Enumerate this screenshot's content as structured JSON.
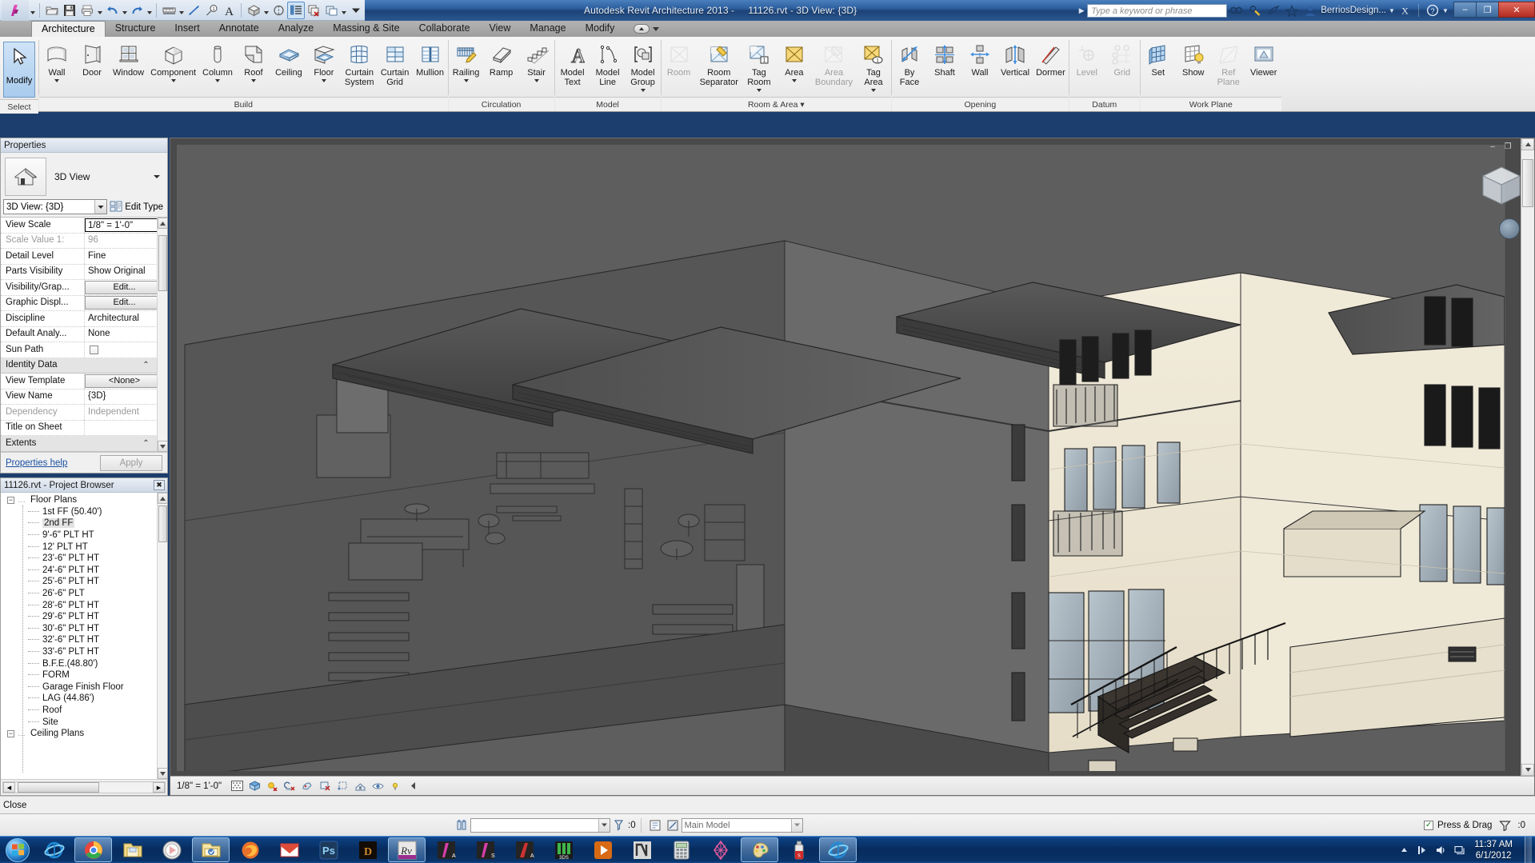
{
  "titlebar": {
    "app_title": "Autodesk Revit Architecture 2013 -",
    "document_title": "11126.rvt - 3D View: {3D}",
    "search_placeholder": "Type a keyword or phrase",
    "account": "BerriosDesign...",
    "quick_access": [
      {
        "name": "open-icon",
        "label": "Open"
      },
      {
        "name": "save-icon",
        "label": "Save"
      },
      {
        "name": "print-icon",
        "label": "Print"
      },
      {
        "name": "undo-icon",
        "label": "Undo"
      },
      {
        "name": "redo-icon",
        "label": "Redo"
      },
      {
        "name": "measure-icon",
        "label": "Measure"
      },
      {
        "name": "aligned-dimension-icon",
        "label": "Aligned Dimension"
      },
      {
        "name": "tag-icon",
        "label": "Tag by Category"
      },
      {
        "name": "text-icon",
        "label": "Text"
      },
      {
        "name": "default-3d-view-icon",
        "label": "Default 3D View"
      },
      {
        "name": "section-icon",
        "label": "Section"
      },
      {
        "name": "thin-lines-icon",
        "label": "Thin Lines"
      },
      {
        "name": "close-hidden-windows-icon",
        "label": "Close Hidden Windows"
      },
      {
        "name": "switch-windows-icon",
        "label": "Switch Windows"
      }
    ],
    "window_buttons": {
      "minimize": "–",
      "restore": "❐",
      "close": "✕"
    }
  },
  "tabs": [
    {
      "label": "Architecture",
      "active": true
    },
    {
      "label": "Structure",
      "active": false
    },
    {
      "label": "Insert",
      "active": false
    },
    {
      "label": "Annotate",
      "active": false
    },
    {
      "label": "Analyze",
      "active": false
    },
    {
      "label": "Massing & Site",
      "active": false
    },
    {
      "label": "Collaborate",
      "active": false
    },
    {
      "label": "View",
      "active": false
    },
    {
      "label": "Manage",
      "active": false
    },
    {
      "label": "Modify",
      "active": false
    }
  ],
  "ribbon": {
    "panels": [
      {
        "label": "Select",
        "buttons": [
          {
            "name": "modify-button",
            "label": "Modify",
            "icon": "cursor-arrow-icon",
            "selected": true,
            "disabled": false
          }
        ]
      },
      {
        "label": "Build",
        "buttons": [
          {
            "name": "wall-button",
            "label": "Wall",
            "icon": "wall-icon",
            "dropdown": true,
            "disabled": false
          },
          {
            "name": "door-button",
            "label": "Door",
            "icon": "door-icon",
            "dropdown": false,
            "disabled": false
          },
          {
            "name": "window-button",
            "label": "Window",
            "icon": "window-icon",
            "dropdown": false,
            "disabled": false
          },
          {
            "name": "component-button",
            "label": "Component",
            "icon": "component-icon",
            "dropdown": true,
            "disabled": false
          },
          {
            "name": "column-button",
            "label": "Column",
            "icon": "column-icon",
            "dropdown": true,
            "disabled": false
          },
          {
            "name": "roof-button",
            "label": "Roof",
            "icon": "roof-icon",
            "dropdown": true,
            "disabled": false
          },
          {
            "name": "ceiling-button",
            "label": "Ceiling",
            "icon": "ceiling-icon",
            "dropdown": false,
            "disabled": false
          },
          {
            "name": "floor-button",
            "label": "Floor",
            "icon": "floor-icon",
            "dropdown": true,
            "disabled": false
          },
          {
            "name": "curtain-system-button",
            "label": "Curtain",
            "label2": "System",
            "icon": "curtain-system-icon",
            "dropdown": false,
            "disabled": false
          },
          {
            "name": "curtain-grid-button",
            "label": "Curtain",
            "label2": "Grid",
            "icon": "curtain-grid-icon",
            "dropdown": false,
            "disabled": false
          },
          {
            "name": "mullion-button",
            "label": "Mullion",
            "icon": "mullion-icon",
            "dropdown": false,
            "disabled": false
          }
        ]
      },
      {
        "label": "Circulation",
        "buttons": [
          {
            "name": "railing-button",
            "label": "Railing",
            "icon": "railing-icon",
            "dropdown": true,
            "disabled": false
          },
          {
            "name": "ramp-button",
            "label": "Ramp",
            "icon": "ramp-icon",
            "dropdown": false,
            "disabled": false
          },
          {
            "name": "stair-button",
            "label": "Stair",
            "icon": "stair-icon",
            "dropdown": true,
            "disabled": false
          }
        ]
      },
      {
        "label": "Model",
        "buttons": [
          {
            "name": "model-text-button",
            "label": "Model",
            "label2": "Text",
            "icon": "model-text-icon",
            "dropdown": false,
            "disabled": false
          },
          {
            "name": "model-line-button",
            "label": "Model",
            "label2": "Line",
            "icon": "model-line-icon",
            "dropdown": false,
            "disabled": false
          },
          {
            "name": "model-group-button",
            "label": "Model",
            "label2": "Group",
            "icon": "model-group-icon",
            "dropdown": true,
            "disabled": false
          }
        ]
      },
      {
        "label": "Room & Area",
        "dropdown": true,
        "buttons": [
          {
            "name": "room-button",
            "label": "Room",
            "icon": "room-icon",
            "dropdown": false,
            "disabled": true
          },
          {
            "name": "room-separator-button",
            "label": "Room",
            "label2": "Separator",
            "icon": "room-separator-icon",
            "dropdown": false,
            "disabled": false
          },
          {
            "name": "tag-room-button",
            "label": "Tag",
            "label2": "Room",
            "icon": "tag-room-icon",
            "dropdown": true,
            "disabled": false
          },
          {
            "name": "area-button",
            "label": "Area",
            "icon": "area-icon",
            "dropdown": true,
            "disabled": false
          },
          {
            "name": "area-boundary-button",
            "label": "Area",
            "label2": "Boundary",
            "icon": "area-boundary-icon",
            "dropdown": false,
            "disabled": true
          },
          {
            "name": "tag-area-button",
            "label": "Tag",
            "label2": "Area",
            "icon": "tag-area-icon",
            "dropdown": true,
            "disabled": false
          }
        ]
      },
      {
        "label": "Opening",
        "buttons": [
          {
            "name": "by-face-button",
            "label": "By",
            "label2": "Face",
            "icon": "by-face-icon",
            "dropdown": false,
            "disabled": false
          },
          {
            "name": "shaft-button",
            "label": "Shaft",
            "icon": "shaft-icon",
            "dropdown": false,
            "disabled": false
          },
          {
            "name": "wall-opening-button",
            "label": "Wall",
            "icon": "wall-opening-icon",
            "dropdown": false,
            "disabled": false
          },
          {
            "name": "vertical-opening-button",
            "label": "Vertical",
            "icon": "vertical-opening-icon",
            "dropdown": false,
            "disabled": false
          },
          {
            "name": "dormer-button",
            "label": "Dormer",
            "icon": "dormer-icon",
            "dropdown": false,
            "disabled": false
          }
        ]
      },
      {
        "label": "Datum",
        "buttons": [
          {
            "name": "level-button",
            "label": "Level",
            "icon": "level-icon",
            "dropdown": false,
            "disabled": true
          },
          {
            "name": "grid-button",
            "label": "Grid",
            "icon": "grid-icon",
            "dropdown": false,
            "disabled": true
          }
        ]
      },
      {
        "label": "Work Plane",
        "buttons": [
          {
            "name": "set-workplane-button",
            "label": "Set",
            "icon": "set-workplane-icon",
            "dropdown": false,
            "disabled": false
          },
          {
            "name": "show-workplane-button",
            "label": "Show",
            "icon": "show-workplane-icon",
            "dropdown": false,
            "disabled": false
          },
          {
            "name": "ref-plane-button",
            "label": "Ref",
            "label2": "Plane",
            "icon": "ref-plane-icon",
            "dropdown": false,
            "disabled": true
          },
          {
            "name": "viewer-button",
            "label": "Viewer",
            "icon": "viewer-icon",
            "dropdown": false,
            "disabled": false
          }
        ]
      }
    ]
  },
  "properties": {
    "title": "Properties",
    "type_name": "3D View",
    "selector_value": "3D View: {3D}",
    "edit_type_label": "Edit Type",
    "rows": [
      {
        "key": "View Scale",
        "value": "1/8\" = 1'-0\"",
        "style": "input"
      },
      {
        "key": "Scale Value    1:",
        "value": "96",
        "style": "dim"
      },
      {
        "key": "Detail Level",
        "value": "Fine",
        "style": "text"
      },
      {
        "key": "Parts Visibility",
        "value": "Show Original",
        "style": "text"
      },
      {
        "key": "Visibility/Grap...",
        "value": "Edit...",
        "style": "button"
      },
      {
        "key": "Graphic Displ...",
        "value": "Edit...",
        "style": "button"
      },
      {
        "key": "Discipline",
        "value": "Architectural",
        "style": "text"
      },
      {
        "key": "Default Analy...",
        "value": "None",
        "style": "text"
      },
      {
        "key": "Sun Path",
        "value": "",
        "style": "checkbox"
      },
      {
        "key": "Identity Data",
        "value": "",
        "style": "group"
      },
      {
        "key": "View Template",
        "value": "<None>",
        "style": "button"
      },
      {
        "key": "View Name",
        "value": "{3D}",
        "style": "text"
      },
      {
        "key": "Dependency",
        "value": "Independent",
        "style": "dim"
      },
      {
        "key": "Title on Sheet",
        "value": "",
        "style": "text"
      },
      {
        "key": "Extents",
        "value": "",
        "style": "group"
      }
    ],
    "help_link": "Properties help",
    "apply_button": "Apply"
  },
  "browser": {
    "title": "11126.rvt - Project Browser",
    "nodes": [
      {
        "label": "Floor Plans",
        "level": 0,
        "expanded": true,
        "selected": false
      },
      {
        "label": "1st FF (50.40')",
        "level": 1,
        "selected": false
      },
      {
        "label": "2nd FF",
        "level": 1,
        "selected": true
      },
      {
        "label": "9'-6\" PLT HT",
        "level": 1,
        "selected": false
      },
      {
        "label": "12' PLT HT",
        "level": 1,
        "selected": false
      },
      {
        "label": "23'-6\" PLT HT",
        "level": 1,
        "selected": false
      },
      {
        "label": "24'-6\" PLT HT",
        "level": 1,
        "selected": false
      },
      {
        "label": "25'-6\" PLT HT",
        "level": 1,
        "selected": false
      },
      {
        "label": "26'-6\" PLT",
        "level": 1,
        "selected": false
      },
      {
        "label": "28'-6\" PLT HT",
        "level": 1,
        "selected": false
      },
      {
        "label": "29'-6\" PLT HT",
        "level": 1,
        "selected": false
      },
      {
        "label": "30'-6\" PLT HT",
        "level": 1,
        "selected": false
      },
      {
        "label": "32'-6\" PLT HT",
        "level": 1,
        "selected": false
      },
      {
        "label": "33'-6\" PLT HT",
        "level": 1,
        "selected": false
      },
      {
        "label": "B.F.E.(48.80')",
        "level": 1,
        "selected": false
      },
      {
        "label": "FORM",
        "level": 1,
        "selected": false
      },
      {
        "label": "Garage Finish Floor",
        "level": 1,
        "selected": false
      },
      {
        "label": "LAG (44.86')",
        "level": 1,
        "selected": false
      },
      {
        "label": "Roof",
        "level": 1,
        "selected": false
      },
      {
        "label": "Site",
        "level": 1,
        "selected": false
      },
      {
        "label": "Ceiling Plans",
        "level": 0,
        "expanded": true,
        "selected": false
      }
    ]
  },
  "view": {
    "scale_label": "1/8\" = 1'-0\"",
    "controls": [
      {
        "name": "detail-level-icon",
        "label": "Detail Level"
      },
      {
        "name": "visual-style-icon",
        "label": "Visual Style"
      },
      {
        "name": "sun-path-icon",
        "label": "Sun Path Off"
      },
      {
        "name": "shadows-icon",
        "label": "Shadows Off"
      },
      {
        "name": "rendering-dialog-icon",
        "label": "Show Rendering Dialog"
      },
      {
        "name": "crop-view-icon",
        "label": "Crop View"
      },
      {
        "name": "show-crop-region-icon",
        "label": "Show Crop Region"
      },
      {
        "name": "lock-3d-view-icon",
        "label": "Lock 3D View"
      },
      {
        "name": "temporary-hide-isolate-icon",
        "label": "Temporary Hide/Isolate"
      },
      {
        "name": "reveal-hidden-elements-icon",
        "label": "Reveal Hidden Elements"
      },
      {
        "name": "toggle-panel-icon",
        "label": "Toggle"
      }
    ],
    "window_buttons": {
      "minimize": "–",
      "restore": "❐",
      "close": "✕"
    }
  },
  "statusbar": {
    "close_label": "Close",
    "filter_count": ":0",
    "model_selector": "Main Model",
    "worksets_value": "",
    "press_drag_label": "Press & Drag",
    "press_drag_checked": true,
    "selection_count": ":0"
  },
  "taskbar": {
    "clock_time": "11:37 AM",
    "clock_date": "6/1/2012",
    "items": [
      {
        "name": "internet-explorer-taskbar-icon",
        "label": "Internet Explorer",
        "active": false
      },
      {
        "name": "google-chrome-taskbar-icon",
        "label": "Google Chrome",
        "active": true
      },
      {
        "name": "file-explorer-taskbar-icon",
        "label": "Windows Explorer",
        "active": false
      },
      {
        "name": "media-player-taskbar-icon",
        "label": "Windows Media Player",
        "active": false
      },
      {
        "name": "outlook-taskbar-icon",
        "label": "Microsoft Outlook",
        "active": true
      },
      {
        "name": "firefox-taskbar-icon",
        "label": "Mozilla Firefox",
        "active": false
      },
      {
        "name": "gmail-taskbar-icon",
        "label": "Gmail",
        "active": false
      },
      {
        "name": "photoshop-taskbar-icon",
        "label": "Adobe Photoshop",
        "active": false
      },
      {
        "name": "diablo-taskbar-icon",
        "label": "Diablo III",
        "active": false
      },
      {
        "name": "revit-taskbar-icon",
        "label": "Revit Architecture",
        "active": true
      },
      {
        "name": "revit-a-taskbar-icon",
        "label": "Revit Architecture 2013",
        "active": false
      },
      {
        "name": "revit-s-taskbar-icon",
        "label": "Revit Structure",
        "active": false
      },
      {
        "name": "autocad-taskbar-icon",
        "label": "AutoCAD",
        "active": false
      },
      {
        "name": "3dsmax-taskbar-icon",
        "label": "3ds Max",
        "active": false
      },
      {
        "name": "player-taskbar-icon",
        "label": "Media Player",
        "active": false
      },
      {
        "name": "navisworks-taskbar-icon",
        "label": "Navisworks",
        "active": false
      },
      {
        "name": "calculator-taskbar-icon",
        "label": "Calculator",
        "active": false
      },
      {
        "name": "showcase-taskbar-icon",
        "label": "Autodesk Showcase",
        "active": false
      },
      {
        "name": "paint-taskbar-icon",
        "label": "Paint",
        "active": true
      },
      {
        "name": "spray-taskbar-icon",
        "label": "Sketchbook",
        "active": false
      },
      {
        "name": "ie2-taskbar-icon",
        "label": "Internet Explorer",
        "active": true
      }
    ],
    "tray": [
      {
        "name": "show-hidden-icons-icon",
        "label": "Show hidden icons"
      },
      {
        "name": "network-icon",
        "label": "Network"
      },
      {
        "name": "volume-icon",
        "label": "Volume"
      },
      {
        "name": "action-center-icon",
        "label": "Action Center"
      }
    ]
  },
  "colors": {
    "accent": "#1f4e8c",
    "ribbon_bg": "#efefef",
    "tab_bar": "#a6a6a6",
    "canvas_bg": "#4a4a4a",
    "model_wall": "#efe9d8",
    "model_shade": "#5c5c5c",
    "roof": "#4c4c4c",
    "taskbar": "#0a3368"
  }
}
